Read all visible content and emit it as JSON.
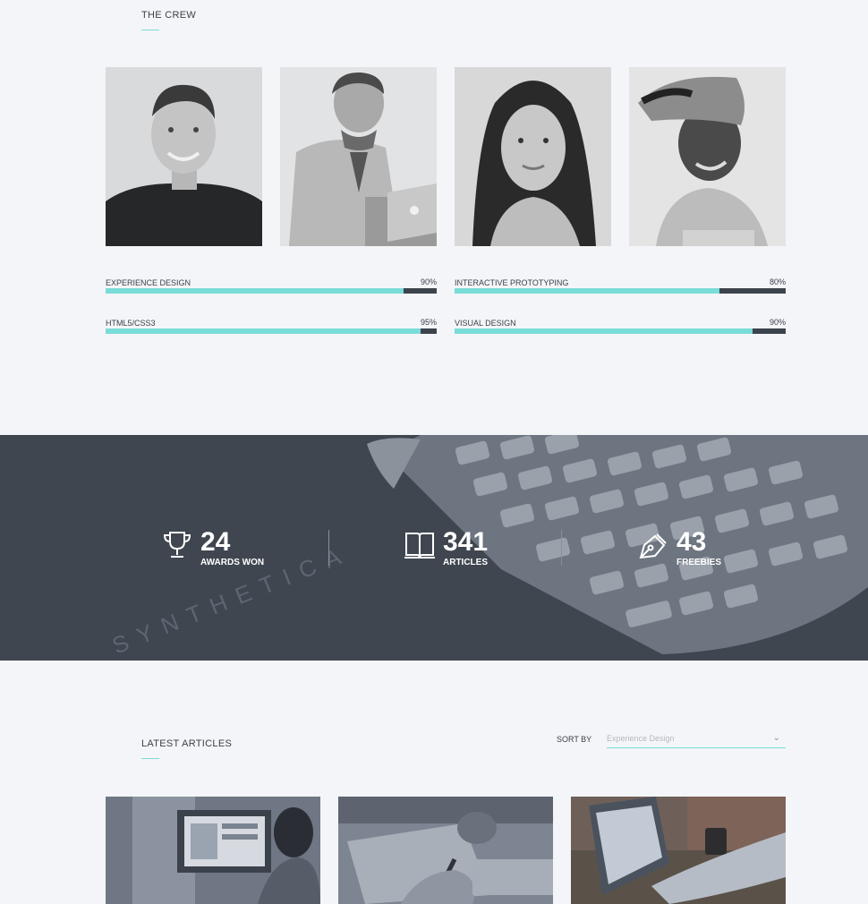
{
  "crew": {
    "title": "THE CREW",
    "members": [
      {
        "photo": "man-smiling-black-shirt"
      },
      {
        "photo": "man-with-laptop"
      },
      {
        "photo": "woman-long-hair"
      },
      {
        "photo": "young-man-cap"
      }
    ],
    "skills": [
      {
        "label": "EXPERIENCE DESIGN",
        "percent_text": "90%",
        "percent": 0.9
      },
      {
        "label": "INTERACTIVE PROTOTYPING",
        "percent_text": "80%",
        "percent": 0.8
      },
      {
        "label": "HTML5/CSS3",
        "percent_text": "95%",
        "percent": 0.95
      },
      {
        "label": "VISUAL DESIGN",
        "percent_text": "90%",
        "percent": 0.9
      }
    ]
  },
  "stats": {
    "background_text": "SYNTHETICA",
    "items": [
      {
        "icon": "trophy-icon",
        "number": "24",
        "caption": "AWARDS WON"
      },
      {
        "icon": "book-icon",
        "number": "341",
        "caption": "ARTICLES"
      },
      {
        "icon": "pen-nib-icon",
        "number": "43",
        "caption": "FREEBIES"
      }
    ]
  },
  "articles": {
    "title": "LATEST ARTICLES",
    "sort_label": "SORT BY",
    "sort_value": "Experience Design",
    "items": [
      {
        "image": "woman-at-computer"
      },
      {
        "image": "hand-writing-notes"
      },
      {
        "image": "hands-on-laptop"
      }
    ]
  },
  "colors": {
    "accent": "#7adcd8",
    "dark": "#3d434d",
    "background": "#f4f5f8",
    "stats_overlay": "#454c56"
  }
}
